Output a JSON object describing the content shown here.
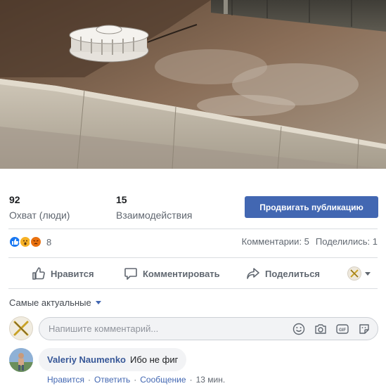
{
  "photo": {
    "subject": "drained-fountain"
  },
  "insights": {
    "reach": {
      "value": "92",
      "label": "Охват (люди)"
    },
    "engagement": {
      "value": "15",
      "label": "Взаимодействия"
    },
    "promote_button": "Продвигать публикацию"
  },
  "reactions": {
    "icons": [
      "like-icon",
      "wow-icon",
      "angry-icon"
    ],
    "count": "8",
    "comments": "Комментарии: 5",
    "shares": "Поделились: 1"
  },
  "actions": {
    "like": "Нравится",
    "comment": "Комментировать",
    "share": "Поделиться"
  },
  "sort": {
    "label": "Самые актуальные"
  },
  "composer": {
    "placeholder": "Напишите комментарий...",
    "tools": [
      "emoji-icon",
      "camera-icon",
      "gif-icon",
      "sticker-icon"
    ]
  },
  "comment": {
    "author": "Valeriy Naumenko",
    "text": "Ибо не фиг",
    "like": "Нравится",
    "reply": "Ответить",
    "message": "Сообщение",
    "time": "13 мин."
  },
  "colors": {
    "accent": "#4267b2",
    "link": "#385898",
    "muted": "#606770",
    "bubble": "#f2f3f5"
  }
}
